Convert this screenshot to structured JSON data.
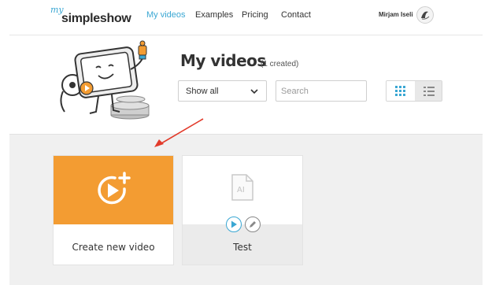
{
  "brand": {
    "logo_prefix": "my",
    "logo_name": "simpleshow",
    "accent": "#3aa7d3",
    "orange": "#f39c32"
  },
  "nav": {
    "items": [
      {
        "label": "My videos",
        "active": true
      },
      {
        "label": "Examples",
        "active": false
      },
      {
        "label": "Pricing",
        "active": false
      },
      {
        "label": "Contact",
        "active": false
      }
    ],
    "user_name": "Mirjam Iseli",
    "avatar_icon": "user-avatar-icon"
  },
  "header": {
    "title": "My videos",
    "created_count": "(1 created)",
    "filter": {
      "selected": "Show all",
      "icon": "chevron-down-icon"
    },
    "search": {
      "placeholder": "Search",
      "value": ""
    },
    "view_toggle": {
      "grid_icon": "grid-view-icon",
      "list_icon": "list-view-icon",
      "active": "grid"
    }
  },
  "cards": [
    {
      "label": "Create new video",
      "icon": "create-video-icon"
    },
    {
      "label": "Test",
      "icon": "document-ai-icon",
      "actions": [
        "play-icon",
        "edit-pencil-icon"
      ]
    }
  ]
}
